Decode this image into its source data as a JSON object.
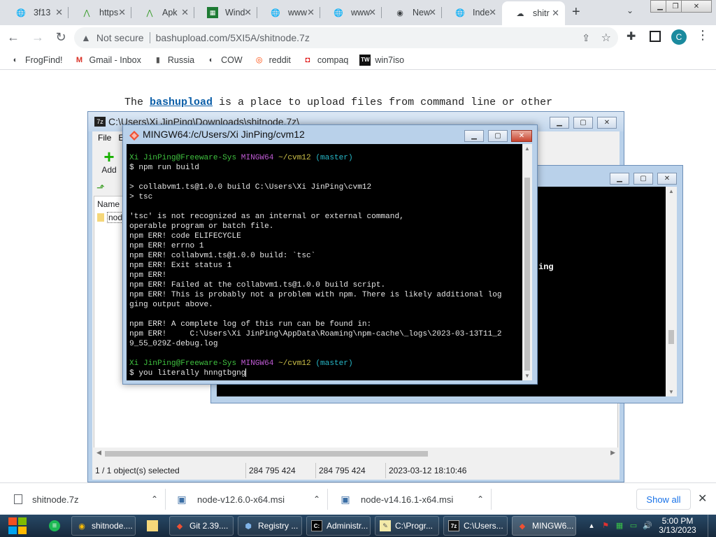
{
  "browser": {
    "tabs": [
      {
        "label": "3f13",
        "icon": "globe-icon"
      },
      {
        "label": "https",
        "icon": "green-a-icon"
      },
      {
        "label": "Apk",
        "icon": "green-a-icon"
      },
      {
        "label": "Wind",
        "icon": "spreadsheet-icon"
      },
      {
        "label": "www",
        "icon": "globe-icon"
      },
      {
        "label": "www",
        "icon": "globe-icon"
      },
      {
        "label": "New",
        "icon": "chrome-icon"
      },
      {
        "label": "Inde",
        "icon": "globe-icon"
      },
      {
        "label": "shitr",
        "icon": "cloud-upload-icon",
        "active": true
      }
    ],
    "address": {
      "security": "Not secure",
      "url": "bashupload.com/5XI5A/shitnode.7z"
    },
    "profile_initial": "C",
    "bookmarks": [
      {
        "label": "FrogFind!",
        "icon": "globe-icon"
      },
      {
        "label": "Gmail - Inbox",
        "icon": "gmail-icon"
      },
      {
        "label": "Russia",
        "icon": "flag-icon"
      },
      {
        "label": "COW",
        "icon": "globe-icon"
      },
      {
        "label": "reddit",
        "icon": "reddit-icon"
      },
      {
        "label": "compaq",
        "icon": "compaq-icon"
      },
      {
        "label": "win7iso",
        "icon": "tw-icon"
      }
    ]
  },
  "page": {
    "intro_before": "The ",
    "intro_link": "bashupload",
    "intro_after": " is a place to upload files from command line or other"
  },
  "sevenzip": {
    "title": "C:\\Users\\Xi JinPing\\Downloads\\shitnode.7z\\",
    "menu_file": "File",
    "menu_e": "E",
    "add_label": "Add",
    "col_name": "Name",
    "row_name": "node",
    "status": {
      "selected": "1 / 1 object(s) selected",
      "size": "284 795 424",
      "packed": "284 795 424",
      "modified": "2023-03-12 18:10:46"
    }
  },
  "console2": {
    "fragment": "ing"
  },
  "mingw": {
    "title": "MINGW64:/c/Users/Xi JinPing/cvm12",
    "prompt_user": "Xi JinPing@Freeware-Sys",
    "prompt_env": "MINGW64",
    "prompt_path": "~/cvm12",
    "prompt_branch": "(master)",
    "lines": [
      "$ npm run build",
      "",
      "> collabvm1.ts@1.0.0 build C:\\Users\\Xi JinPing\\cvm12",
      "> tsc",
      "",
      "'tsc' is not recognized as an internal or external command,",
      "operable program or batch file.",
      "npm ERR! code ELIFECYCLE",
      "npm ERR! errno 1",
      "npm ERR! collabvm1.ts@1.0.0 build: `tsc`",
      "npm ERR! Exit status 1",
      "npm ERR!",
      "npm ERR! Failed at the collabvm1.ts@1.0.0 build script.",
      "npm ERR! This is probably not a problem with npm. There is likely additional log",
      "ging output above.",
      "",
      "npm ERR! A complete log of this run can be found in:",
      "npm ERR!     C:\\Users\\Xi JinPing\\AppData\\Roaming\\npm-cache\\_logs\\2023-03-13T11_2",
      "9_55_029Z-debug.log",
      ""
    ],
    "last_command": "$ you literally hnngtbgng"
  },
  "downloads": [
    {
      "name": "shitnode.7z",
      "icon": "file-icon"
    },
    {
      "name": "node-v12.6.0-x64.msi",
      "icon": "installer-icon"
    },
    {
      "name": "node-v14.16.1-x64.msi",
      "icon": "installer-icon"
    }
  ],
  "downloads_show_all": "Show all",
  "taskbar": {
    "items": [
      {
        "label": "",
        "icon": "green-app-icon"
      },
      {
        "label": "shitnode....",
        "icon": "chrome-icon"
      },
      {
        "label": "",
        "icon": "folder-icon"
      },
      {
        "label": "Git 2.39....",
        "icon": "git-installer-icon"
      },
      {
        "label": "Registry ...",
        "icon": "registry-icon"
      },
      {
        "label": "Administr...",
        "icon": "cmd-icon"
      },
      {
        "label": "C:\\Progr...",
        "icon": "notepad-icon"
      },
      {
        "label": "C:\\Users...",
        "icon": "7zip-icon"
      },
      {
        "label": "MINGW6...",
        "icon": "git-bash-icon"
      }
    ],
    "time": "5:00 PM",
    "date": "3/13/2023"
  }
}
